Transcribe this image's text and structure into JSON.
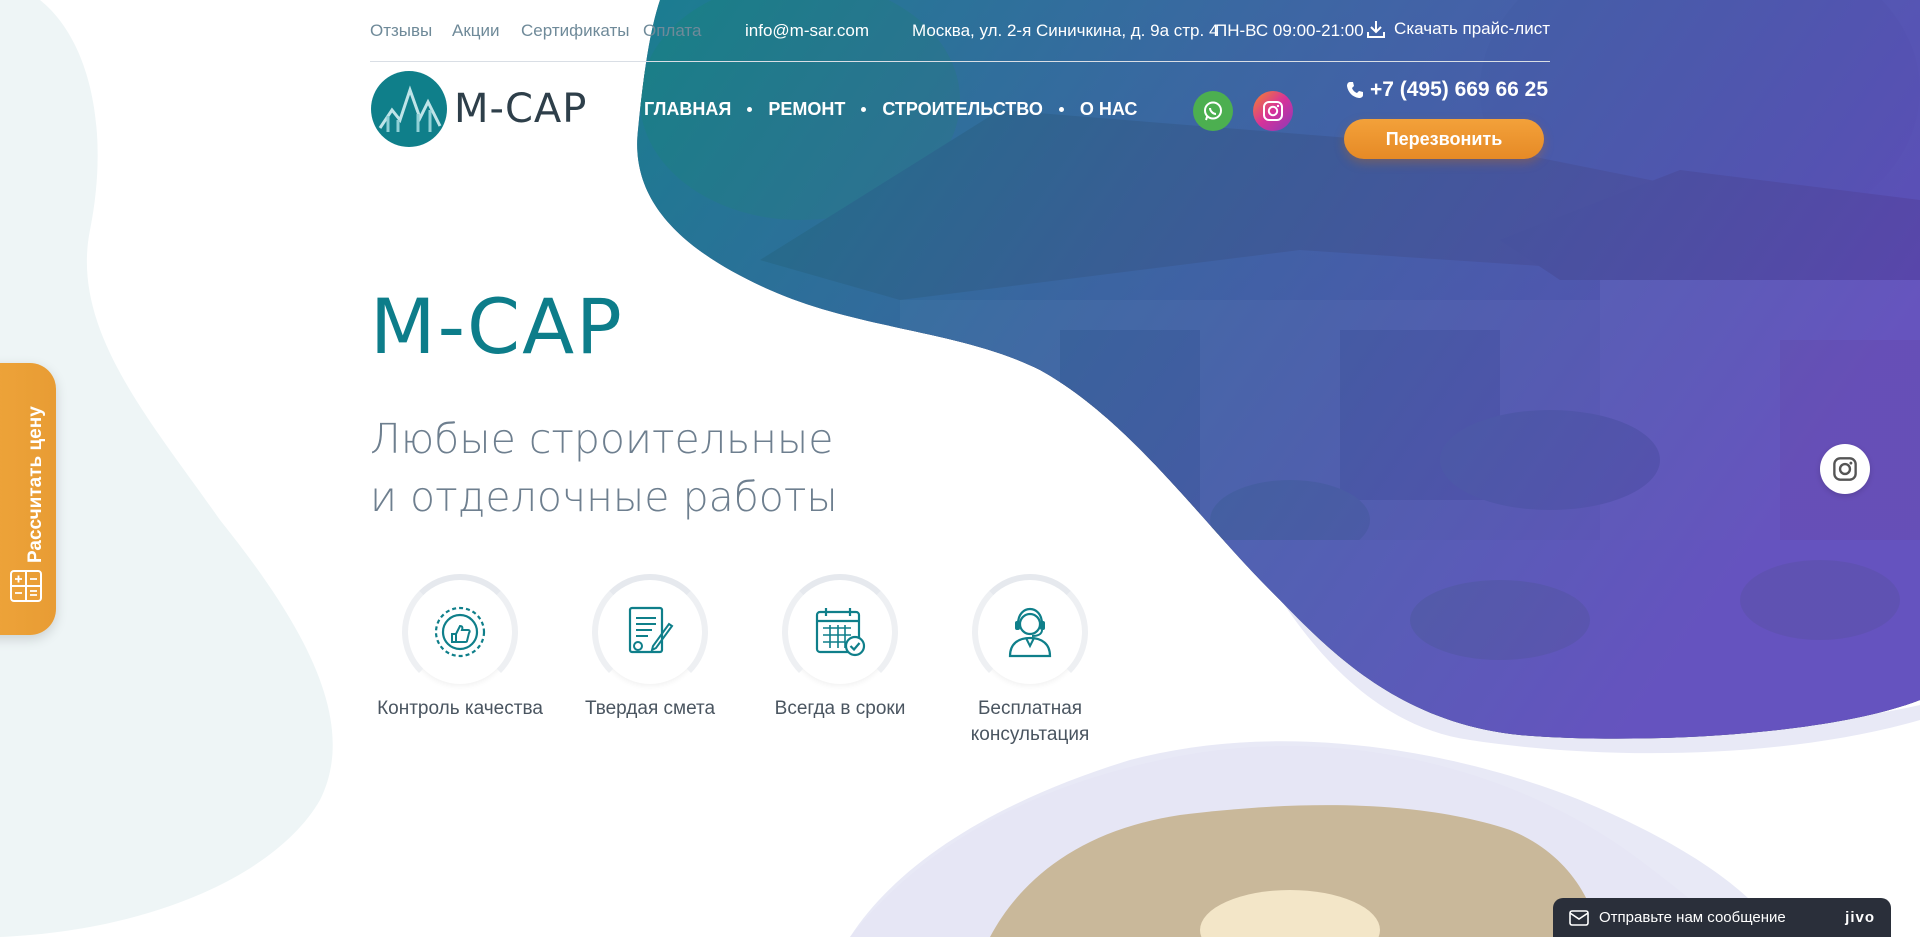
{
  "topbar": {
    "links": [
      "Отзывы",
      "Акции",
      "Сертификаты",
      "Оплата"
    ],
    "email": "info@m-sar.com",
    "address": "Москва, ул. 2-я Синичкина, д. 9а стр. 4",
    "hours": "ПН-ВС 09:00-21:00",
    "download_label": "Скачать прайс-лист"
  },
  "logo": {
    "text": "М-САР"
  },
  "nav": {
    "items": [
      "ГЛАВНАЯ",
      "РЕМОНТ",
      "СТРОИТЕЛЬСТВО",
      "О НАС"
    ]
  },
  "contact": {
    "phone": "+7 (495) 669 66 25",
    "callback_label": "Перезвонить"
  },
  "hero": {
    "title": "М-САР",
    "subtitle_line1": "Любые строительные",
    "subtitle_line2": "и отделочные работы"
  },
  "features": [
    {
      "label": "Контроль качества",
      "icon": "quality-badge-icon"
    },
    {
      "label": "Твердая смета",
      "icon": "contract-icon"
    },
    {
      "label": "Всегда в сроки",
      "icon": "calendar-icon"
    },
    {
      "label": "Бесплатная консультация",
      "icon": "headset-operator-icon"
    }
  ],
  "sidetab": {
    "label": "Рассчитать цену"
  },
  "chat": {
    "label": "Отправьте нам сообщение",
    "brand": "jivo"
  },
  "colors": {
    "accent": "#0d7d8a",
    "orange": "#e89c34",
    "overlay_start": "#128a96",
    "overlay_end": "#6a4fcf",
    "whatsapp": "#4caf50",
    "instagram": "#d6329a"
  }
}
